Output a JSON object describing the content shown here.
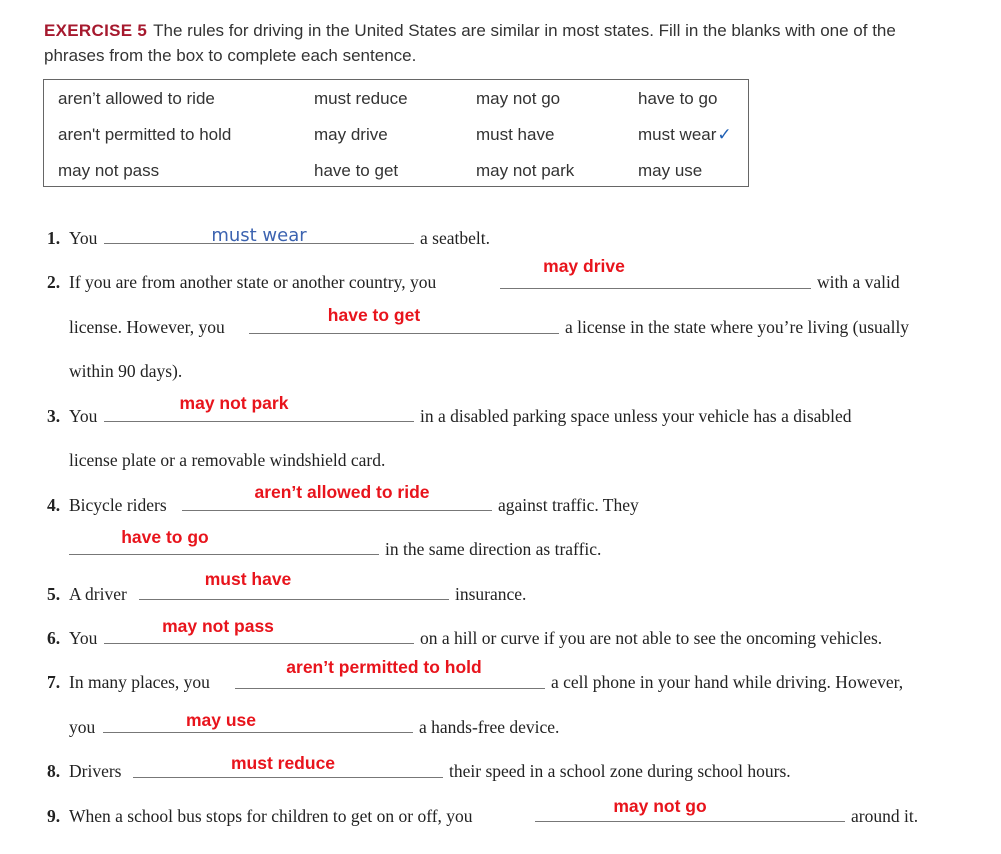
{
  "instructions": {
    "label": "EXERCISE 5",
    "text": "The rules for driving in the United States are similar in most states. Fill in the blanks with one of the phrases from the box to complete each sentence."
  },
  "word_box": {
    "rows": [
      [
        "aren’t allowed to ride",
        "must reduce",
        "may not go",
        "have to go"
      ],
      [
        "aren't permitted to hold",
        "may drive",
        "must have",
        "must wear"
      ],
      [
        "may not pass",
        "have to get",
        "may not park",
        "may use"
      ]
    ],
    "checkmark": "✓"
  },
  "items": [
    {
      "num": "1.",
      "lines": [
        "You",
        "a seatbelt."
      ],
      "answers": [
        "must wear"
      ]
    },
    {
      "num": "2.",
      "lines": [
        "If you are from another state or another country, you",
        "with a valid",
        "license. However, you",
        "a license in the state where you’re living (usually",
        "within 90 days)."
      ],
      "answers": [
        "may drive",
        "have to get"
      ]
    },
    {
      "num": "3.",
      "lines": [
        "You",
        "in a disabled parking space unless your vehicle has a disabled",
        "license plate or a removable windshield card."
      ],
      "answers": [
        "may not park"
      ]
    },
    {
      "num": "4.",
      "lines": [
        "Bicycle riders",
        "against traffic. They",
        "in the same direction as traffic."
      ],
      "answers": [
        "aren’t allowed to ride",
        "have to go"
      ]
    },
    {
      "num": "5.",
      "lines": [
        "A driver",
        "insurance."
      ],
      "answers": [
        "must have"
      ]
    },
    {
      "num": "6.",
      "lines": [
        "You",
        "on a hill or curve if you are not able to see the oncoming vehicles."
      ],
      "answers": [
        "may not pass"
      ]
    },
    {
      "num": "7.",
      "lines": [
        "In many places, you",
        "a cell phone in your hand while driving. However,",
        "you",
        "a hands-free device."
      ],
      "answers": [
        "aren’t permitted to hold",
        "may use"
      ]
    },
    {
      "num": "8.",
      "lines": [
        "Drivers",
        "their speed in a school zone during school hours."
      ],
      "answers": [
        "must reduce"
      ]
    },
    {
      "num": "9.",
      "lines": [
        "When a school bus stops for children to get on or off, you",
        "around it."
      ],
      "answers": [
        "may not go"
      ]
    }
  ],
  "colors": {
    "exercise_label": "#a6192e",
    "answer_red": "#e8141c",
    "handwriting_blue": "#3c63b0"
  }
}
